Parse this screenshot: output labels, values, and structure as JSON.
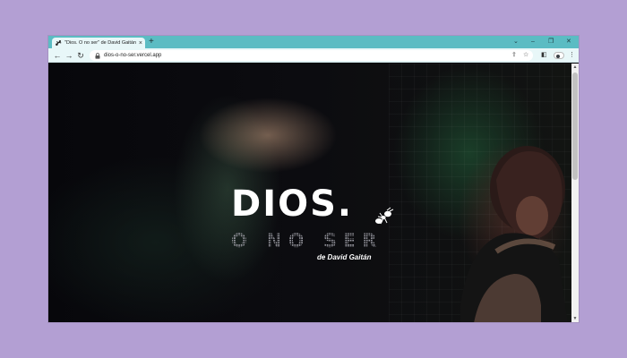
{
  "browser": {
    "tab_title": "\"Dios. O no ser\" de David Gaitán",
    "tab_close": "×",
    "new_tab": "+",
    "url": "dios-o-no-ser.vercel.app",
    "controls": {
      "dropdown": "⌄",
      "minimize": "–",
      "restore": "❐",
      "close": "✕"
    },
    "nav": {
      "back": "←",
      "forward": "→",
      "reload": "↻"
    },
    "omnibox_icons": {
      "share": "⇪",
      "bookmark": "☆"
    },
    "toolbar_icons": {
      "sidebar": "◧",
      "menu": "⋮"
    },
    "scroll": {
      "up": "▲",
      "down": "▼"
    }
  },
  "hero": {
    "title": "DIOS.",
    "subtitle": "O NO SER",
    "credit": "de David Gaitán"
  },
  "colors": {
    "page_background": "#b39fd3",
    "tab_strip": "#5bbcc3",
    "toolbar": "#e8f7f8",
    "hero_text": "#ffffff"
  }
}
